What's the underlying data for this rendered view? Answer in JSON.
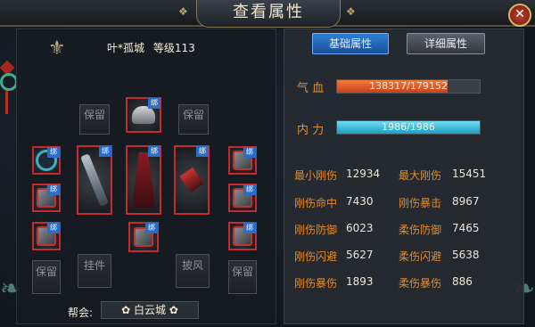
{
  "window": {
    "title": "查看属性",
    "close_label": "✕"
  },
  "character": {
    "name": "叶*孤城",
    "level_label": "等级113"
  },
  "equipment": {
    "reserve_label": "保留",
    "pendant_label": "挂件",
    "cloak_label": "披风",
    "bind_badge": "绑",
    "empty_reserve_top_left": "保留",
    "empty_reserve_top_right": "保留",
    "empty_reserve_bottom_left": "保留",
    "empty_reserve_bottom_right": "保留"
  },
  "guild": {
    "label": "帮会:",
    "name": "✿ 白云城 ✿"
  },
  "tabs": {
    "basic": "基础属性",
    "detail": "详细属性"
  },
  "hp": {
    "label": "气  血",
    "text": "138317/179152",
    "fraction": 0.772
  },
  "mp": {
    "label": "内  力",
    "text": "1986/1986",
    "fraction": 1.0
  },
  "stats": [
    {
      "label": "最小刚伤",
      "value": "12934"
    },
    {
      "label": "最大刚伤",
      "value": "15451"
    },
    {
      "label": "刚伤命中",
      "value": "7430"
    },
    {
      "label": "刚伤暴击",
      "value": "8967"
    },
    {
      "label": "刚伤防御",
      "value": "6023"
    },
    {
      "label": "柔伤防御",
      "value": "7465"
    },
    {
      "label": "刚伤闪避",
      "value": "5627"
    },
    {
      "label": "柔伤闪避",
      "value": "5638"
    },
    {
      "label": "刚伤暴伤",
      "value": "1893"
    },
    {
      "label": "柔伤暴伤",
      "value": "886"
    }
  ],
  "colors": {
    "hp_fill": "#e8582a",
    "mp_fill": "#35c3e6",
    "accent_tab": "#2f7fd6"
  }
}
